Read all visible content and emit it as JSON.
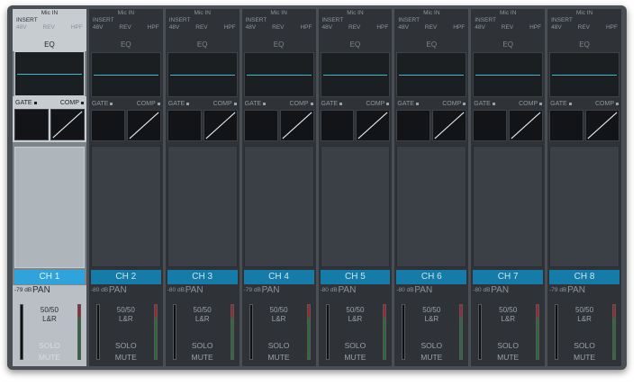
{
  "mixer": {
    "eq_label": "EQ",
    "gate_label": "GATE",
    "comp_label": "COMP",
    "pan_label": "PAN",
    "solo_label": "SOLO",
    "mute_label": "MUTE",
    "io": {
      "line1": "Mic IN",
      "line2": "INSERT",
      "phantom": "48V",
      "rev": "REV",
      "hpf": "HPF"
    },
    "accent_color": "#157ba8",
    "selected_color": "#2fa3dc",
    "eq_curve_color": "#3fb8d3",
    "meter_red": "#a0242a",
    "meter_green": "#2c6b39",
    "channels": [
      {
        "name": "CH 1",
        "db": "-79 dB",
        "pan": "50/50",
        "bus": "L&R",
        "selected": true
      },
      {
        "name": "CH 2",
        "db": "-80 dB",
        "pan": "50/50",
        "bus": "L&R",
        "selected": false
      },
      {
        "name": "CH 3",
        "db": "-80 dB",
        "pan": "50/50",
        "bus": "L&R",
        "selected": false
      },
      {
        "name": "CH 4",
        "db": "-79 dB",
        "pan": "50/50",
        "bus": "L&R",
        "selected": false
      },
      {
        "name": "CH 5",
        "db": "-80 dB",
        "pan": "50/50",
        "bus": "L&R",
        "selected": false
      },
      {
        "name": "CH 6",
        "db": "-80 dB",
        "pan": "50/50",
        "bus": "L&R",
        "selected": false
      },
      {
        "name": "CH 7",
        "db": "-80 dB",
        "pan": "50/50",
        "bus": "L&R",
        "selected": false
      },
      {
        "name": "CH 8",
        "db": "-79 dB",
        "pan": "50/50",
        "bus": "L&R",
        "selected": false
      }
    ]
  }
}
